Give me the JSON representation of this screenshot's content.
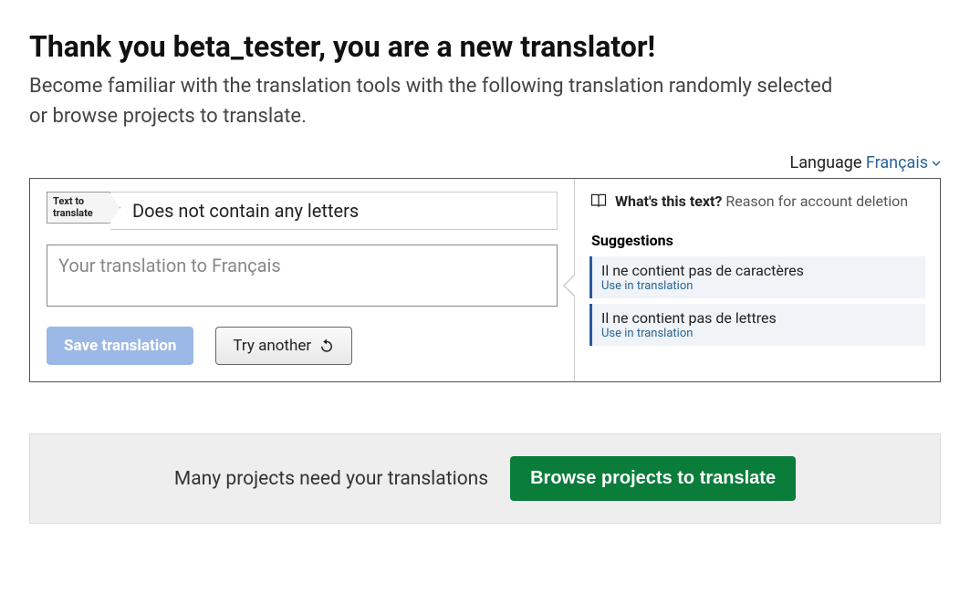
{
  "heading": "Thank you beta_tester, you are a new translator!",
  "subheading": "Become familiar with the translation tools with the following translation randomly selected or browse projects to translate.",
  "language": {
    "label": "Language",
    "value": "Français"
  },
  "source": {
    "label": "Text to translate",
    "text": "Does not contain any letters"
  },
  "input": {
    "placeholder": "Your translation to Français"
  },
  "buttons": {
    "save": "Save translation",
    "try_another": "Try another"
  },
  "context": {
    "whats_this": "What's this text?",
    "reason": "Reason for account deletion"
  },
  "suggestions": {
    "heading": "Suggestions",
    "items": [
      {
        "text": "Il ne contient pas de caractères",
        "action": "Use in translation"
      },
      {
        "text": "Il ne contient pas de lettres",
        "action": "Use in translation"
      }
    ]
  },
  "banner": {
    "text": "Many projects need your translations",
    "button": "Browse projects to translate"
  }
}
